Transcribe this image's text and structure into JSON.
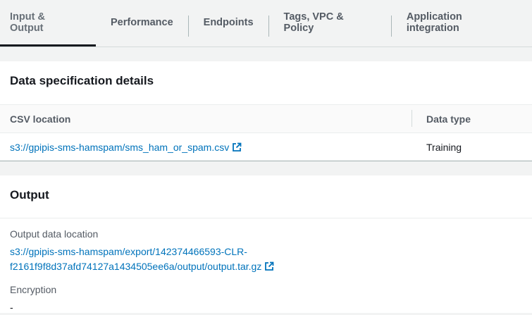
{
  "tabs": [
    {
      "label": "Input & Output",
      "active": true
    },
    {
      "label": "Performance"
    },
    {
      "label": "Endpoints"
    },
    {
      "label": "Tags, VPC & Policy"
    },
    {
      "label": "Application integration"
    }
  ],
  "data_spec": {
    "title": "Data specification details",
    "columns": [
      "CSV location",
      "Data type"
    ],
    "rows": [
      {
        "csv_location": "s3://gpipis-sms-hamspam/sms_ham_or_spam.csv",
        "data_type": "Training"
      }
    ]
  },
  "output": {
    "title": "Output",
    "data_location_label": "Output data location",
    "data_location_line1": "s3://gpipis-sms-hamspam/export/142374466593-CLR-",
    "data_location_line2": "f2161f9f8d37afd74127a1434505ee6a/output/output.tar.gz",
    "encryption_label": "Encryption",
    "encryption_value": "-"
  },
  "icons": {
    "external_link": "external-link-icon"
  },
  "colors": {
    "link": "#0073bb",
    "background": "#f2f3f3",
    "text": "#16191f",
    "muted": "#545b64"
  }
}
